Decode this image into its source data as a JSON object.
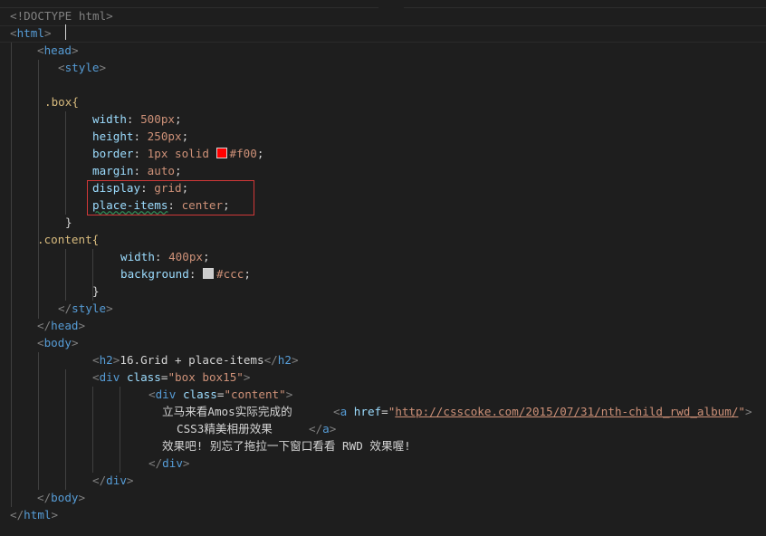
{
  "editor": {
    "lines": {
      "l1": "<!DOCTYPE html>",
      "l2_open": "<",
      "l2_tag": "html",
      "l2_close": ">",
      "l3_open": "<",
      "l3_tag": "head",
      "l3_close": ">",
      "l4_open": "<",
      "l4_tag": "style",
      "l4_close": ">",
      "l6_sel": ".box{",
      "l7_prop": "width",
      "l7_colon": ": ",
      "l7_val": "500px",
      "l7_end": ";",
      "l8_prop": "height",
      "l8_colon": ": ",
      "l8_val": "250px",
      "l8_end": ";",
      "l9_prop": "border",
      "l9_colon": ": ",
      "l9_val": "1px solid ",
      "l9_color": "#f00",
      "l9_end": ";",
      "l10_prop": "margin",
      "l10_colon": ": ",
      "l10_val": "auto",
      "l10_end": ";",
      "l11_prop": "display",
      "l11_colon": ": ",
      "l11_val": "grid",
      "l11_end": ";",
      "l12_prop": "place-items",
      "l12_colon": ": ",
      "l12_val": "center",
      "l12_end": ";",
      "l13": "}",
      "l14_sel": ".content{",
      "l15_prop": "width",
      "l15_colon": ": ",
      "l15_val": "400px",
      "l15_end": ";",
      "l16_prop": "background",
      "l16_colon": ": ",
      "l16_color": "#ccc",
      "l16_end": ";",
      "l17": "}",
      "l18_open": "</",
      "l18_tag": "style",
      "l18_close": ">",
      "l19_open": "</",
      "l19_tag": "head",
      "l19_close": ">",
      "l20_open": "<",
      "l20_tag": "body",
      "l20_close": ">",
      "l21_open": "<",
      "l21_tag": "h2",
      "l21_close": ">",
      "l21_text": "16.Grid + place-items",
      "l21_eopen": "</",
      "l21_etag": "h2",
      "l21_eclose": ">",
      "l22_open": "<",
      "l22_tag": "div",
      "l22_attr": "class",
      "l22_eq": "=",
      "l22_val": "\"box box15\"",
      "l22_close": ">",
      "l23_open": "<",
      "l23_tag": "div",
      "l23_attr": "class",
      "l23_eq": "=",
      "l23_val": "\"content\"",
      "l23_close": ">",
      "l24_text": "立马来看Amos实际完成的",
      "l24_open": "<",
      "l24_tag": "a",
      "l24_attr": "href",
      "l24_eq": "=",
      "l24_q1": "\"",
      "l24_url": "http://csscoke.com/2015/07/31/nth-child_rwd_album/",
      "l24_q2": "\"",
      "l24_close": ">",
      "l25_text": "CSS3精美相册效果",
      "l25_open": "</",
      "l25_tag": "a",
      "l25_close": ">",
      "l26_text": "效果吧! 别忘了拖拉一下窗口看看 RWD 效果喔!",
      "l27_open": "</",
      "l27_tag": "div",
      "l27_close": ">",
      "l28_open": "</",
      "l28_tag": "div",
      "l28_close": ">",
      "l29_open": "</",
      "l29_tag": "body",
      "l29_close": ">",
      "l30_open": "</",
      "l30_tag": "html",
      "l30_close": ">"
    },
    "swatch_colors": {
      "red": "#ff0000",
      "gray": "#cccccc"
    }
  }
}
